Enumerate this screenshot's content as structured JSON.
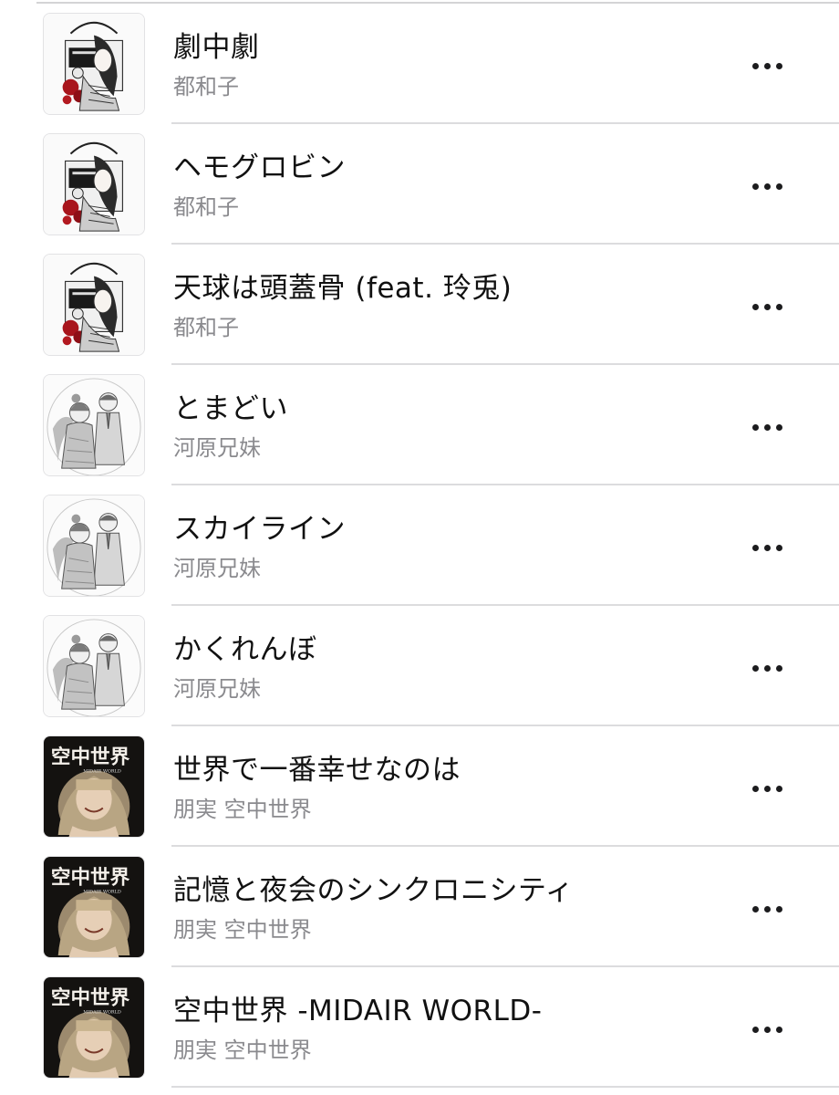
{
  "songs": [
    {
      "title": "劇中劇",
      "artist": "都和子",
      "artwork": "gothic-girl-artwork"
    },
    {
      "title": "ヘモグロビン",
      "artist": "都和子",
      "artwork": "gothic-girl-artwork"
    },
    {
      "title": "天球は頭蓋骨 (feat. 玲兎)",
      "artist": "都和子",
      "artwork": "gothic-girl-artwork"
    },
    {
      "title": "とまどい",
      "artist": "河原兄妹",
      "artwork": "sketch-siblings-artwork"
    },
    {
      "title": "スカイライン",
      "artist": "河原兄妹",
      "artwork": "sketch-siblings-artwork"
    },
    {
      "title": "かくれんぼ",
      "artist": "河原兄妹",
      "artwork": "sketch-siblings-artwork"
    },
    {
      "title": "世界で一番幸せなのは",
      "artist": "朋実 空中世界",
      "artwork": "midair-world-artwork"
    },
    {
      "title": "記憶と夜会のシンクロニシティ",
      "artist": "朋実 空中世界",
      "artwork": "midair-world-artwork"
    },
    {
      "title": "空中世界 -MIDAIR WORLD-",
      "artist": "朋実 空中世界",
      "artwork": "midair-world-artwork"
    }
  ],
  "artwork_text": {
    "midair_title": "空中世界",
    "midair_subtitle": "MIDAIR WORLD"
  },
  "colors": {
    "title_text": "#111111",
    "artist_text": "#8a8a8e",
    "separator": "#dcdcde",
    "more_dots": "#1c1c1e"
  },
  "icons": {
    "more": "more-horizontal-icon"
  }
}
